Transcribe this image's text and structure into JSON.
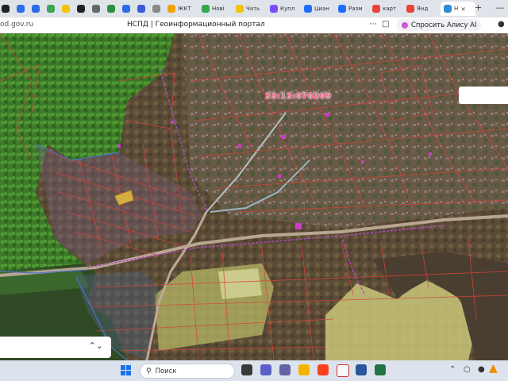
{
  "browser": {
    "tabs": [
      {
        "label": "",
        "icon": "pin-icon",
        "color": "#222222"
      },
      {
        "label": "",
        "icon": "calendar-icon",
        "color": "#2b6de6"
      },
      {
        "label": "",
        "icon": "chat-icon",
        "color": "#2b6de6"
      },
      {
        "label": "",
        "icon": "sync-icon",
        "color": "#3aa757"
      },
      {
        "label": "",
        "icon": "yandex-eye-icon",
        "color": "#f5c400"
      },
      {
        "label": "",
        "icon": "arrow-icon",
        "color": "#222222"
      },
      {
        "label": "",
        "icon": "document-icon",
        "color": "#666666"
      },
      {
        "label": "",
        "icon": "shield-icon",
        "color": "#2a8f3a"
      },
      {
        "label": "",
        "icon": "gallery-icon",
        "color": "#2b6de6"
      },
      {
        "label": "",
        "icon": "mail-icon",
        "color": "#3b5bdb"
      },
      {
        "label": "",
        "icon": "circle-icon",
        "color": "#888888"
      },
      {
        "label": "ЖКТ",
        "icon": "article-icon",
        "color": "#f0a400"
      },
      {
        "label": "Нові",
        "icon": "refresh-icon",
        "color": "#2fa84f"
      },
      {
        "label": "Чать",
        "icon": "yandex-eye-icon",
        "color": "#f5c400"
      },
      {
        "label": "Купл",
        "icon": "market-icon",
        "color": "#7b4dff"
      },
      {
        "label": "Циан",
        "icon": "cian-icon",
        "color": "#1f6fff"
      },
      {
        "label": "Разм",
        "icon": "cian-icon",
        "color": "#1f6fff"
      },
      {
        "label": "карт",
        "icon": "map-pin-icon",
        "color": "#ea4335"
      },
      {
        "label": "Янд",
        "icon": "map-pin-icon",
        "color": "#ea4335"
      },
      {
        "label": "Н",
        "icon": "map-icon",
        "color": "#2b8bd6",
        "active": true
      }
    ],
    "new_tab_symbol": "+",
    "close_symbol": "×",
    "url": "od.gov.ru",
    "page_title": "НСПД | Геоинформационный портал",
    "alice_label": "Спросить Алису AI"
  },
  "map": {
    "cadastral_number": "33:13:070209"
  },
  "panel": {
    "chevron": "⌃⌄"
  },
  "taskbar": {
    "search_placeholder": "Поиск",
    "apps": [
      {
        "icon": "task-view-icon",
        "color": "#3a3a3a"
      },
      {
        "icon": "video-call-icon",
        "color": "#5b5fc7"
      },
      {
        "icon": "teams-icon",
        "color": "#6264a7"
      },
      {
        "icon": "file-explorer-icon",
        "color": "#f4b400"
      },
      {
        "icon": "yandex-icon",
        "color": "#fc3f1d"
      },
      {
        "icon": "yandex-browser-icon",
        "color": "#f7f7f7"
      },
      {
        "icon": "word-icon",
        "color": "#2b579a"
      },
      {
        "icon": "excel-icon",
        "color": "#217346"
      }
    ]
  }
}
